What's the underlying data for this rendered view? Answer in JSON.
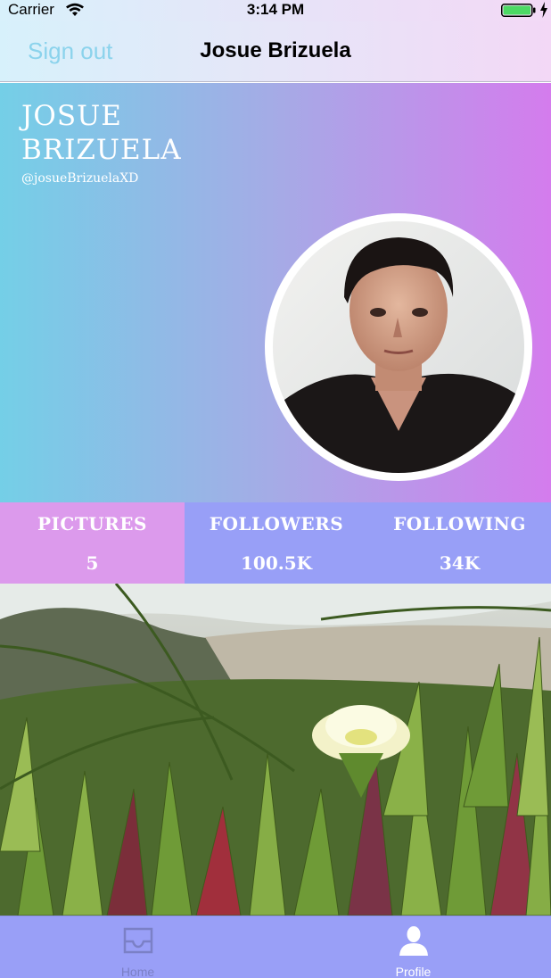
{
  "status_bar": {
    "carrier": "Carrier",
    "time": "3:14 PM",
    "battery_color": "#4cd964"
  },
  "nav": {
    "sign_out_label": "Sign out",
    "title": "Josue Brizuela"
  },
  "profile": {
    "display_name": "JOSUE BRIZUELA",
    "handle": "@josueBrizuelaXD"
  },
  "stats": [
    {
      "label": "PICTURES",
      "value": "5"
    },
    {
      "label": "FOLLOWERS",
      "value": "100.5K"
    },
    {
      "label": "FOLLOWING",
      "value": "34K"
    }
  ],
  "tabs": [
    {
      "label": "Home",
      "icon": "inbox-icon",
      "selected": false
    },
    {
      "label": "Profile",
      "icon": "person-icon",
      "selected": true
    }
  ],
  "colors": {
    "accent_blue": "#74cfe7",
    "accent_purple": "#d47ced",
    "stat_pink": "#dc9aec",
    "stat_blue": "#989ff7",
    "tab_bar": "#999ff7"
  }
}
